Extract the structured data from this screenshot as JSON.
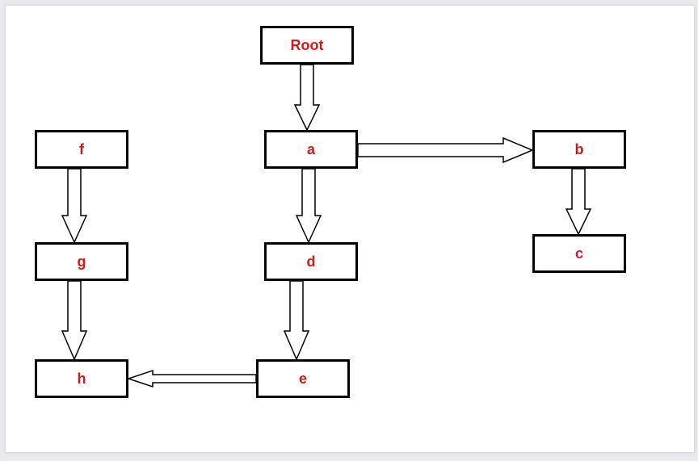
{
  "nodes": {
    "root": "Root",
    "a": "a",
    "b": "b",
    "c": "c",
    "d": "d",
    "e": "e",
    "f": "f",
    "g": "g",
    "h": "h"
  },
  "edges": [
    {
      "from": "root",
      "to": "a"
    },
    {
      "from": "a",
      "to": "b"
    },
    {
      "from": "a",
      "to": "d"
    },
    {
      "from": "b",
      "to": "c"
    },
    {
      "from": "d",
      "to": "e"
    },
    {
      "from": "e",
      "to": "h"
    },
    {
      "from": "f",
      "to": "g"
    },
    {
      "from": "g",
      "to": "h"
    }
  ]
}
